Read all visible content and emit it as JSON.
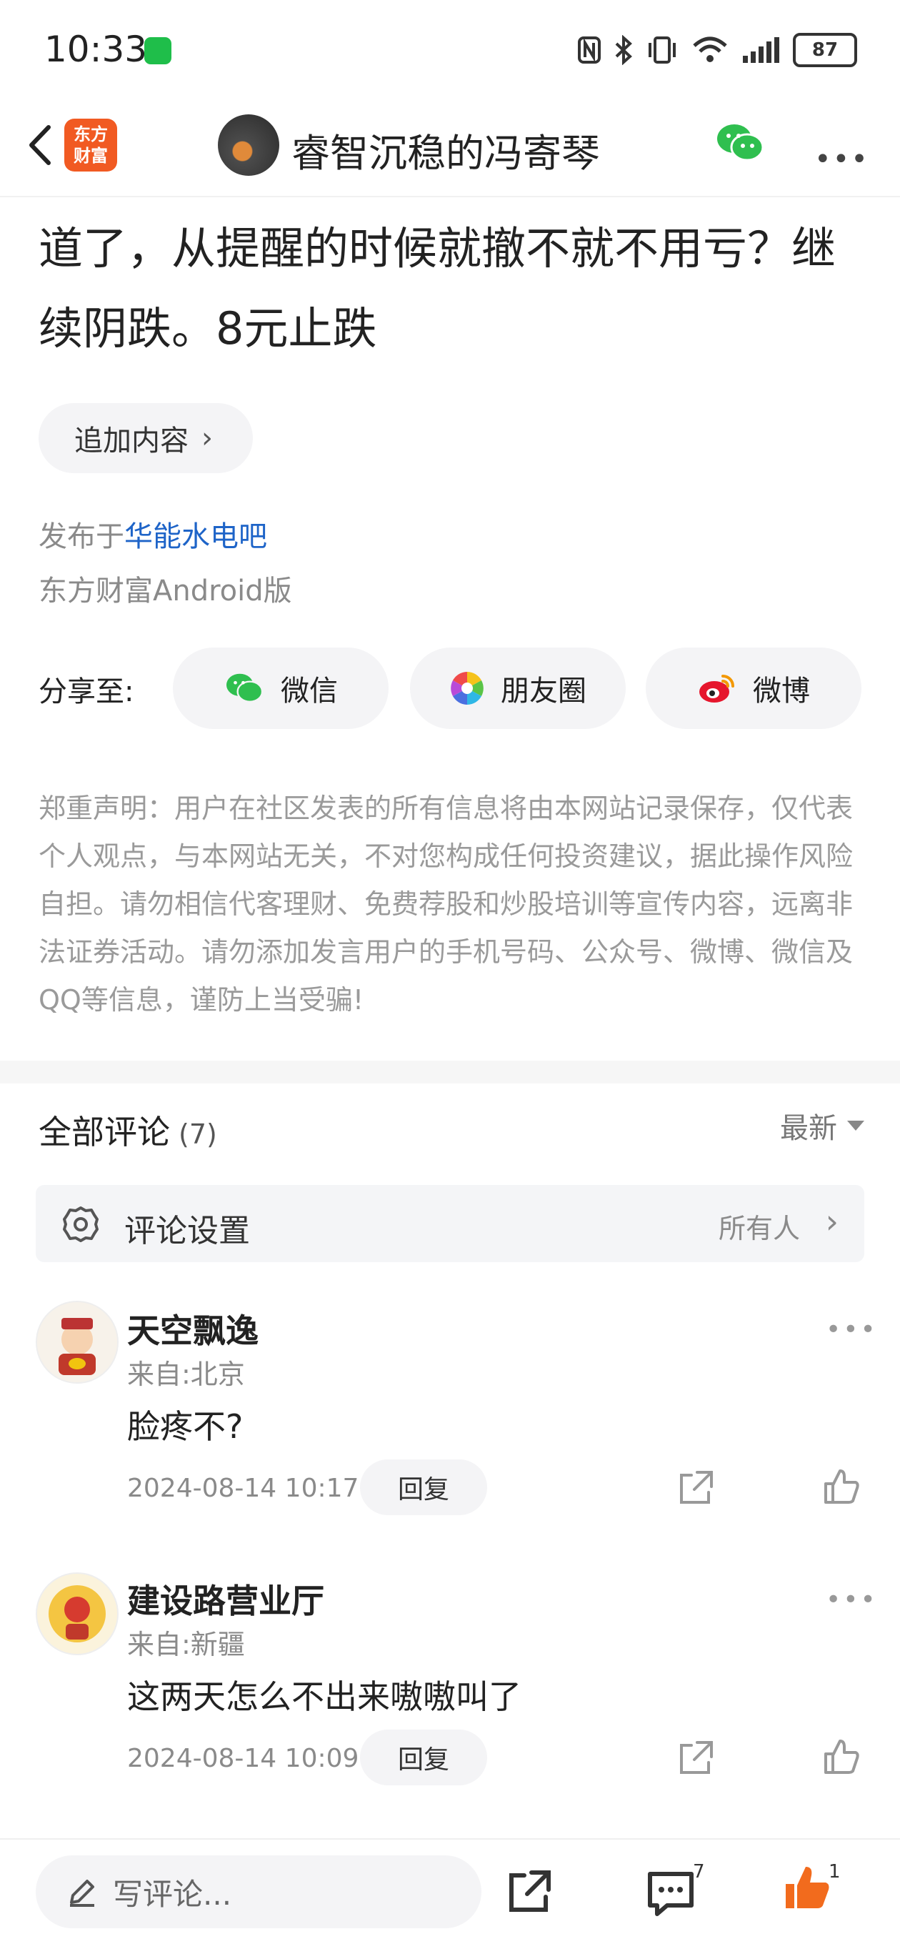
{
  "status_bar": {
    "time": "10:33",
    "battery": "87"
  },
  "header": {
    "app_logo": "东方\n财富",
    "title": "睿智沉稳的冯寄琴"
  },
  "article": {
    "text": "道了，从提醒的时候就撤不就不用亏？继续阴跌。8元止跌",
    "append_label": "追加内容",
    "published_prefix": "发布于",
    "published_bar": "华能水电吧",
    "client": "东方财富Android版"
  },
  "share": {
    "label": "分享至:",
    "targets": [
      {
        "label": "微信"
      },
      {
        "label": "朋友圈"
      },
      {
        "label": "微博"
      }
    ]
  },
  "disclaimer": "郑重声明：用户在社区发表的所有信息将由本网站记录保存，仅代表个人观点，与本网站无关，不对您构成任何投资建议，据此操作风险自担。请勿相信代客理财、免费荐股和炒股培训等宣传内容，远离非法证券活动。请勿添加发言用户的手机号码、公众号、微博、微信及QQ等信息，谨防上当受骗!",
  "comments_section": {
    "title": "全部评论",
    "count": "(7)",
    "sort": "最新",
    "settings_label": "评论设置",
    "settings_value": "所有人",
    "items": [
      {
        "name": "天空飘逸",
        "location": "来自:北京",
        "text": "脸疼不?",
        "date": "2024-08-14 10:17",
        "reply": "回复"
      },
      {
        "name": "建设路营业厅",
        "location": "来自:新疆",
        "text": "这两天怎么不出来嗷嗷叫了",
        "date": "2024-08-14 10:09",
        "reply": "回复"
      }
    ]
  },
  "bottom_bar": {
    "write_placeholder": "写评论...",
    "comment_count": "7",
    "like_count": "1"
  },
  "colors": {
    "accent": "#f15a22",
    "link": "#1e64c8",
    "like": "#f26b1d"
  }
}
